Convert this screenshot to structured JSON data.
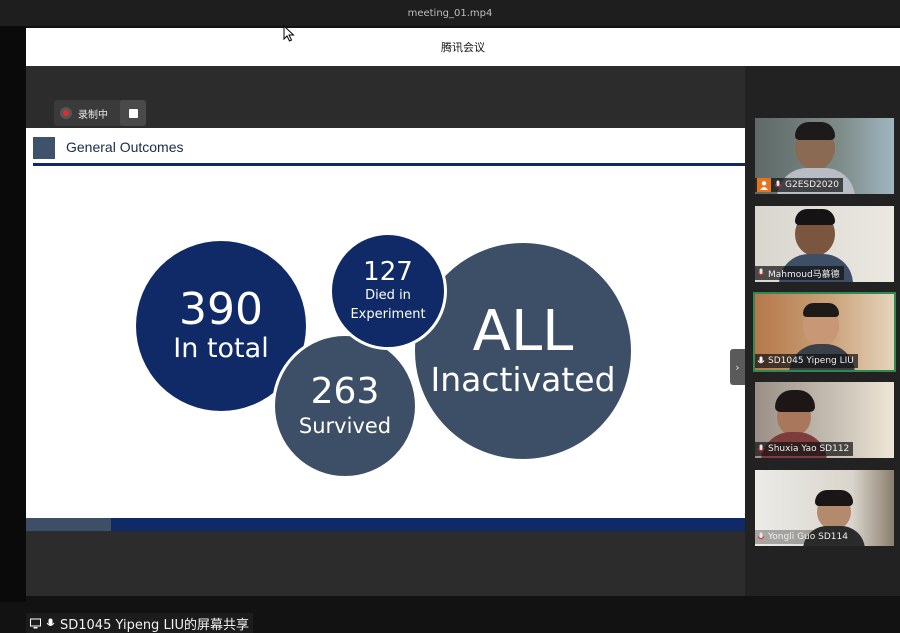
{
  "player": {
    "file_name": "meeting_01.mp4"
  },
  "app": {
    "title": "腾讯会议"
  },
  "recording": {
    "label": "录制中"
  },
  "slide": {
    "title": "General Outcomes",
    "bubbles": [
      {
        "number": "390",
        "label": "In total"
      },
      {
        "number": "127",
        "label_line1": "Died in",
        "label_line2": "Experiment"
      },
      {
        "number": "263",
        "label": "Survived"
      },
      {
        "number": "ALL",
        "label": "Inactivated"
      }
    ]
  },
  "share_label": "SD1045 Yipeng LIU的屏幕共享",
  "participants": [
    {
      "name": "G2ESD2020",
      "has_avatar_badge": true
    },
    {
      "name": "Mahmoud马慕德"
    },
    {
      "name": "SD1045 Yipeng LIU",
      "active": true
    },
    {
      "name": "Shuxia Yao SD112"
    },
    {
      "name": "Yongli Guo SD114"
    }
  ],
  "colors": {
    "navy": "#0f2a66",
    "slate": "#3d4f66",
    "active_border": "#2e8a4f",
    "record_red": "#e02d2d",
    "avatar_orange": "#e8731f"
  },
  "icons": [
    "record-dot-icon",
    "stop-icon",
    "chevron-right-icon",
    "screen-share-icon",
    "mic-icon",
    "user-avatar-icon",
    "cursor-icon"
  ]
}
